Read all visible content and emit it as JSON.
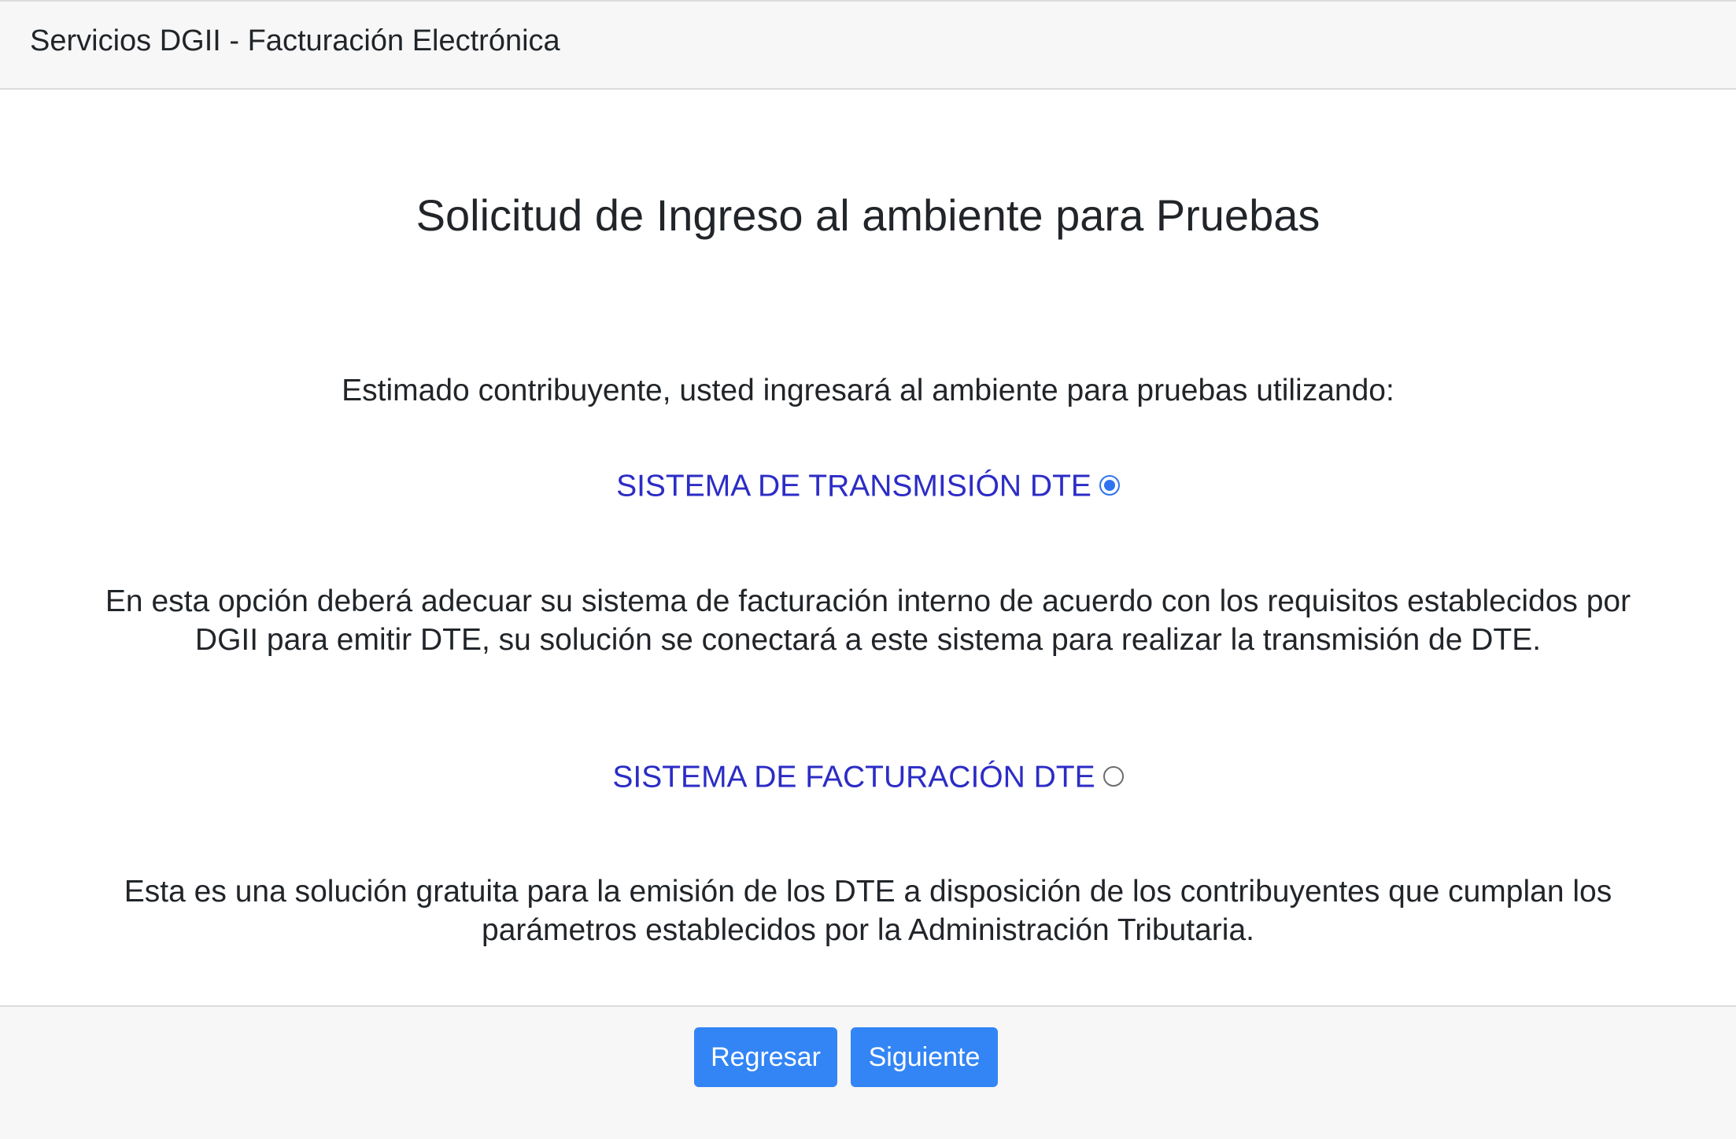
{
  "header": {
    "title": "Servicios DGII - Facturación Electrónica"
  },
  "main": {
    "title": "Solicitud de Ingreso al ambiente para Pruebas",
    "intro": "Estimado contribuyente, usted ingresará al ambiente para pruebas utilizando:",
    "options": [
      {
        "label": "SISTEMA DE TRANSMISIÓN DTE",
        "selected": true,
        "description": [
          "En esta opción deberá adecuar su sistema de facturación interno de acuerdo con los requisitos establecidos por",
          "DGII para emitir DTE, su solución se conectará a este sistema para realizar la transmisión de DTE."
        ]
      },
      {
        "label": "SISTEMA DE FACTURACIÓN DTE",
        "selected": false,
        "description": [
          "Esta es una solución gratuita para la emisión de los DTE a disposición de los contribuyentes que cumplan los",
          "parámetros establecidos por la Administración Tributaria."
        ]
      }
    ]
  },
  "footer": {
    "back_label": "Regresar",
    "next_label": "Siguiente"
  },
  "colors": {
    "option_text": "#2c2cc6",
    "button_bg": "#3385f5",
    "radio_accent": "#2f73f0",
    "header_bg": "#f7f7f7"
  }
}
